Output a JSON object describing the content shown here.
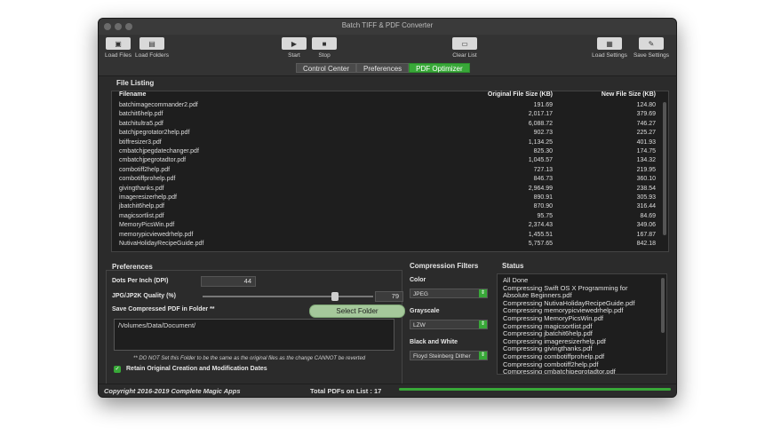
{
  "window": {
    "title": "Batch TIFF & PDF Converter"
  },
  "toolbar": {
    "load_files": "Load Files",
    "load_folders": "Load Folders",
    "start": "Start",
    "stop": "Stop",
    "clear_list": "Clear List",
    "load_settings": "Load Settings",
    "save_settings": "Save Settings"
  },
  "tabs": [
    "Control Center",
    "Preferences",
    "PDF Optimizer"
  ],
  "file_listing": {
    "label": "File Listing",
    "headers": [
      "Filename",
      "Original File Size (KB)",
      "New File Size (KB)"
    ],
    "rows": [
      [
        "batchimagecommander2.pdf",
        "191.69",
        "124.80"
      ],
      [
        "batchit6help.pdf",
        "2,017.17",
        "379.69"
      ],
      [
        "batchitultra5.pdf",
        "6,088.72",
        "746.27"
      ],
      [
        "batchjpegrotator2help.pdf",
        "902.73",
        "225.27"
      ],
      [
        "btiffresizer3.pdf",
        "1,134.25",
        "401.93"
      ],
      [
        "cmbatchjpegdatechanger.pdf",
        "825.30",
        "174.75"
      ],
      [
        "cmbatchjpegrotadtor.pdf",
        "1,045.57",
        "134.32"
      ],
      [
        "combotiff2help.pdf",
        "727.13",
        "219.95"
      ],
      [
        "combotiffprohelp.pdf",
        "846.73",
        "360.10"
      ],
      [
        "givingthanks.pdf",
        "2,964.99",
        "238.54"
      ],
      [
        "imageresizerhelp.pdf",
        "890.91",
        "305.93"
      ],
      [
        "jbatchit6help.pdf",
        "870.90",
        "316.44"
      ],
      [
        "magicsortlist.pdf",
        "95.75",
        "84.69"
      ],
      [
        "MemoryPicsWin.pdf",
        "2,374.43",
        "349.06"
      ],
      [
        "memorypicviewedrhelp.pdf",
        "1,455.51",
        "167.87"
      ],
      [
        "NutivaHolidayRecipeGuide.pdf",
        "5,757.65",
        "842.18"
      ]
    ]
  },
  "preferences": {
    "label": "Preferences",
    "dpi_label": "Dots Per Inch (DPI)",
    "dpi_value": "44",
    "quality_label": "JPG/JP2K Quality (%)",
    "quality_value": "79",
    "quality_fraction": 0.79,
    "save_folder_label": "Save Compressed PDF in Folder **",
    "select_folder": "Select Folder",
    "folder_path": "/Volumes/Data/Document/",
    "warning": "** DO NOT Set this Folder to be the same as the original files as the change CANNOT be reverted",
    "retain_dates": "Retain Original Creation and Modification Dates"
  },
  "compression_filters": {
    "label": "Compression Filters",
    "color_label": "Color",
    "color_value": "JPEG",
    "grayscale_label": "Grayscale",
    "grayscale_value": "LZW",
    "bw_label": "Black and White",
    "bw_value": "Floyd Steinberg Dither"
  },
  "status": {
    "label": "Status",
    "lines": [
      "All Done",
      "Compressing Swift OS X Programming for",
      "Absolute Beginners.pdf",
      "Compressing NutivaHolidayRecipeGuide.pdf",
      "Compressing memorypicviewedrhelp.pdf",
      "Compressing MemoryPicsWin.pdf",
      "Compressing magicsortlist.pdf",
      "Compressing jbatchit6help.pdf",
      "Compressing imageresizerhelp.pdf",
      "Compressing givingthanks.pdf",
      "Compressing combotiffprohelp.pdf",
      "Compressing combotiff2help.pdf",
      "Compressing cmbatchjpegrotadtor.pdf"
    ]
  },
  "footer": {
    "copyright": "Copyright 2016-2019 Complete Magic Apps",
    "total": "Total PDFs on List : 17",
    "progress_fraction": 1.0
  },
  "colors": {
    "accent": "#38a838",
    "window_bg": "#2b2b2b"
  }
}
